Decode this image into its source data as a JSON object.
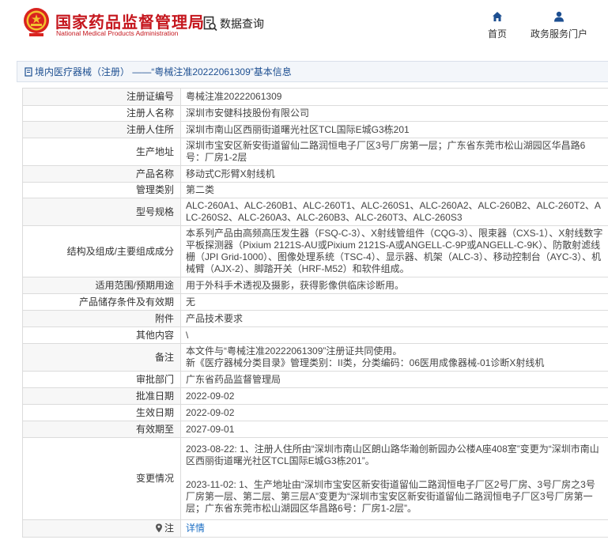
{
  "header": {
    "brand_cn": "国家药品监督管理局",
    "brand_en": "National Medical Products Administration",
    "query_label": "数据查询",
    "nav": {
      "home_label": "首页",
      "service_label": "政务服务门户"
    }
  },
  "page": {
    "title": "境内医疗器械（注册） ——“粤械注准20222061309”基本信息"
  },
  "colors": {
    "brand_red": "#c5161d",
    "link_blue": "#1d6fc4",
    "nav_blue": "#1d4f91"
  },
  "rows": [
    {
      "label": "注册证编号",
      "value": "粤械注准20222061309"
    },
    {
      "label": "注册人名称",
      "value": "深圳市安健科技股份有限公司"
    },
    {
      "label": "注册人住所",
      "value": "深圳市南山区西丽街道曙光社区TCL国际E城G3栋201"
    },
    {
      "label": "生产地址",
      "value": "深圳市宝安区新安街道留仙二路润恒电子厂区3号厂房第一层；广东省东莞市松山湖园区华昌路6号：厂房1-2层"
    },
    {
      "label": "产品名称",
      "value": "移动式C形臂X射线机"
    },
    {
      "label": "管理类别",
      "value": "第二类"
    },
    {
      "label": "型号规格",
      "value": "ALC-260A1、ALC-260B1、ALC-260T1、ALC-260S1、ALC-260A2、ALC-260B2、ALC-260T2、ALC-260S2、ALC-260A3、ALC-260B3、ALC-260T3、ALC-260S3"
    },
    {
      "label": "结构及组成/主要组成成分",
      "value": "本系列产品由高频高压发生器（FSQ-C-3）、X射线管组件（CQG-3）、限束器（CXS-1）、X射线数字平板探测器（Pixium 2121S-AU或Pixium 2121S-A或ANGELL-C-9P或ANGELL-C-9K）、防散射滤线栅（JPI Grid-1000）、图像处理系统（TSC-4）、显示器、机架（ALC-3）、移动控制台（AYC-3）、机械臂（AJX-2）、脚踏开关（HRF-M52）和软件组成。"
    },
    {
      "label": "适用范围/预期用途",
      "value": "用于外科手术透视及摄影，获得影像供临床诊断用。"
    },
    {
      "label": "产品储存条件及有效期",
      "value": "无"
    },
    {
      "label": "附件",
      "value": "产品技术要求"
    },
    {
      "label": "其他内容",
      "value": "\\"
    },
    {
      "label": "备注",
      "value_lines": [
        "本文件与“粤械注准20222061309”注册证共同使用。",
        "新《医疗器械分类目录》管理类别：II类，分类编码：06医用成像器械-01诊断X射线机"
      ]
    },
    {
      "label": "审批部门",
      "value": "广东省药品监督管理局"
    },
    {
      "label": "批准日期",
      "value": "2022-09-02"
    },
    {
      "label": "生效日期",
      "value": "2022-09-02"
    },
    {
      "label": "有效期至",
      "value": "2027-09-01"
    },
    {
      "label": "变更情况",
      "value_lines": [
        "2023-08-22: 1、注册人住所由“深圳市南山区朗山路华瀚创新园办公楼A座408室”变更为“深圳市南山区西丽街道曙光社区TCL国际E城G3栋201”。",
        "",
        "2023-11-02: 1、生产地址由“深圳市宝安区新安街道留仙二路润恒电子厂区2号厂房、3号厂房之3号厂房第一层、第二层、第三层A”变更为“深圳市宝安区新安街道留仙二路润恒电子厂区3号厂房第一层；广东省东莞市松山湖园区华昌路6号：厂房1-2层”。"
      ]
    },
    {
      "label": "注",
      "label_icon": "map-pin-icon",
      "value": "详情",
      "link": true
    }
  ]
}
